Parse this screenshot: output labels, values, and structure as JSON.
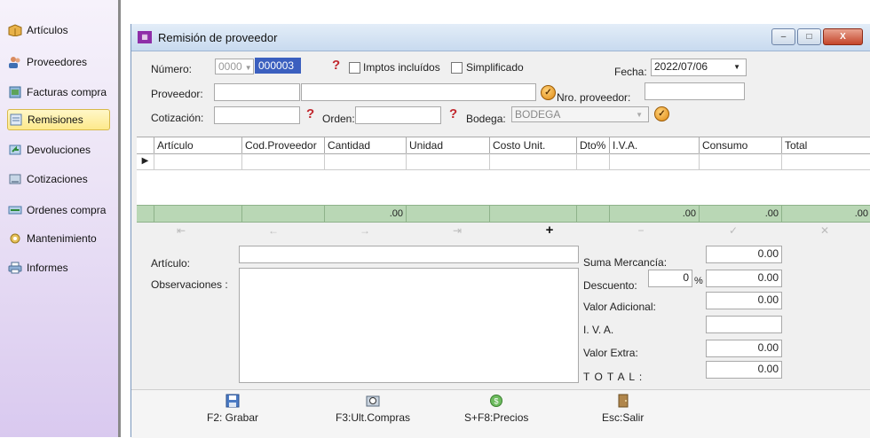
{
  "sidebar": {
    "items": [
      {
        "label": "Artículos",
        "icon": "box-icon",
        "active": false
      },
      {
        "label": "Proveedores",
        "icon": "users-icon",
        "active": false
      },
      {
        "label": "Facturas compra",
        "icon": "invoice-icon",
        "active": false
      },
      {
        "label": "Remisiones",
        "icon": "document-icon",
        "active": true
      },
      {
        "label": "Devoluciones",
        "icon": "return-icon",
        "active": false
      },
      {
        "label": "Cotizaciones",
        "icon": "quote-icon",
        "active": false
      },
      {
        "label": "Ordenes compra",
        "icon": "order-icon",
        "active": false
      },
      {
        "label": "Mantenimiento",
        "icon": "wrench-icon",
        "active": false
      },
      {
        "label": "Informes",
        "icon": "printer-icon",
        "active": false
      }
    ]
  },
  "window": {
    "title": "Remisión de proveedor",
    "buttons": {
      "minimize": "–",
      "maximize": "□",
      "close": "X"
    }
  },
  "form": {
    "numero_label": "Número:",
    "numero_prefix": "0000",
    "numero_value": "000003",
    "imptos_label": "Imptos incluídos",
    "simplificado_label": "Simplificado",
    "fecha_label": "Fecha:",
    "fecha_value": "2022/07/06",
    "proveedor_label": "Proveedor:",
    "nro_proveedor_label": "Nro. proveedor:",
    "cotizacion_label": "Cotización:",
    "orden_label": "Orden:",
    "bodega_label": "Bodega:",
    "bodega_value": "BODEGA"
  },
  "grid": {
    "columns": [
      "Artículo",
      "Cod.Proveedor",
      "Cantidad",
      "Unidad",
      "Costo Unit.",
      "Dto%",
      "I.V.A.",
      "Consumo",
      "Total"
    ],
    "totals": [
      "",
      "",
      ".00",
      "",
      "",
      "",
      ".00",
      ".00",
      ".00"
    ]
  },
  "nav": {
    "first": "⇤",
    "prev": "←",
    "next": "→",
    "last": "⇥",
    "add": "+",
    "remove": "−",
    "confirm": "✓",
    "cancel": "✕"
  },
  "detail": {
    "articulo_label": "Artículo:",
    "observaciones_label": "Observaciones :"
  },
  "summary": {
    "suma_label": "Suma Mercancía:",
    "suma_value": "0.00",
    "descuento_label": "Descuento:",
    "descuento_pct": "0",
    "pct_sign": "%",
    "descuento_value": "0.00",
    "valor_adicional_label": "Valor Adicional:",
    "valor_adicional_value": "0.00",
    "iva_label": "I. V. A.",
    "iva_value": "",
    "valor_extra_label": "Valor Extra:",
    "valor_extra_value": "0.00",
    "total_label": "T O T A L :",
    "total_value": "0.00"
  },
  "toolbar": {
    "grabar": "F2: Grabar",
    "ult_compras": "F3:Ult.Compras",
    "precios": "S+F8:Precios",
    "salir": "Esc:Salir"
  }
}
